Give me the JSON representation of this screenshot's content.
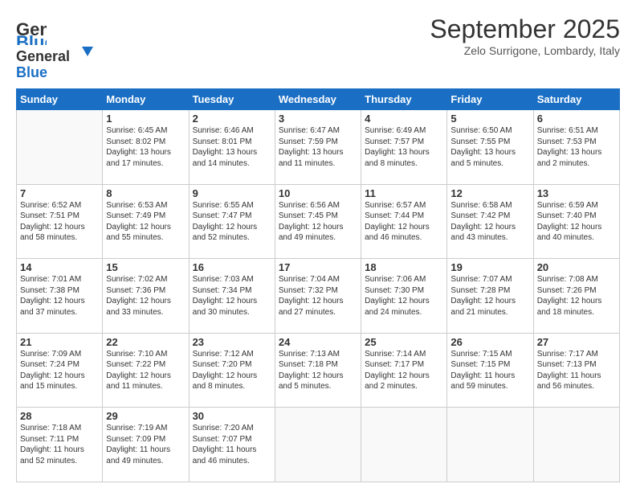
{
  "header": {
    "logo_general": "General",
    "logo_blue": "Blue",
    "title": "September 2025",
    "location": "Zelo Surrigone, Lombardy, Italy"
  },
  "weekdays": [
    "Sunday",
    "Monday",
    "Tuesday",
    "Wednesday",
    "Thursday",
    "Friday",
    "Saturday"
  ],
  "weeks": [
    [
      {
        "day": "",
        "info": ""
      },
      {
        "day": "1",
        "info": "Sunrise: 6:45 AM\nSunset: 8:02 PM\nDaylight: 13 hours\nand 17 minutes."
      },
      {
        "day": "2",
        "info": "Sunrise: 6:46 AM\nSunset: 8:01 PM\nDaylight: 13 hours\nand 14 minutes."
      },
      {
        "day": "3",
        "info": "Sunrise: 6:47 AM\nSunset: 7:59 PM\nDaylight: 13 hours\nand 11 minutes."
      },
      {
        "day": "4",
        "info": "Sunrise: 6:49 AM\nSunset: 7:57 PM\nDaylight: 13 hours\nand 8 minutes."
      },
      {
        "day": "5",
        "info": "Sunrise: 6:50 AM\nSunset: 7:55 PM\nDaylight: 13 hours\nand 5 minutes."
      },
      {
        "day": "6",
        "info": "Sunrise: 6:51 AM\nSunset: 7:53 PM\nDaylight: 13 hours\nand 2 minutes."
      }
    ],
    [
      {
        "day": "7",
        "info": "Sunrise: 6:52 AM\nSunset: 7:51 PM\nDaylight: 12 hours\nand 58 minutes."
      },
      {
        "day": "8",
        "info": "Sunrise: 6:53 AM\nSunset: 7:49 PM\nDaylight: 12 hours\nand 55 minutes."
      },
      {
        "day": "9",
        "info": "Sunrise: 6:55 AM\nSunset: 7:47 PM\nDaylight: 12 hours\nand 52 minutes."
      },
      {
        "day": "10",
        "info": "Sunrise: 6:56 AM\nSunset: 7:45 PM\nDaylight: 12 hours\nand 49 minutes."
      },
      {
        "day": "11",
        "info": "Sunrise: 6:57 AM\nSunset: 7:44 PM\nDaylight: 12 hours\nand 46 minutes."
      },
      {
        "day": "12",
        "info": "Sunrise: 6:58 AM\nSunset: 7:42 PM\nDaylight: 12 hours\nand 43 minutes."
      },
      {
        "day": "13",
        "info": "Sunrise: 6:59 AM\nSunset: 7:40 PM\nDaylight: 12 hours\nand 40 minutes."
      }
    ],
    [
      {
        "day": "14",
        "info": "Sunrise: 7:01 AM\nSunset: 7:38 PM\nDaylight: 12 hours\nand 37 minutes."
      },
      {
        "day": "15",
        "info": "Sunrise: 7:02 AM\nSunset: 7:36 PM\nDaylight: 12 hours\nand 33 minutes."
      },
      {
        "day": "16",
        "info": "Sunrise: 7:03 AM\nSunset: 7:34 PM\nDaylight: 12 hours\nand 30 minutes."
      },
      {
        "day": "17",
        "info": "Sunrise: 7:04 AM\nSunset: 7:32 PM\nDaylight: 12 hours\nand 27 minutes."
      },
      {
        "day": "18",
        "info": "Sunrise: 7:06 AM\nSunset: 7:30 PM\nDaylight: 12 hours\nand 24 minutes."
      },
      {
        "day": "19",
        "info": "Sunrise: 7:07 AM\nSunset: 7:28 PM\nDaylight: 12 hours\nand 21 minutes."
      },
      {
        "day": "20",
        "info": "Sunrise: 7:08 AM\nSunset: 7:26 PM\nDaylight: 12 hours\nand 18 minutes."
      }
    ],
    [
      {
        "day": "21",
        "info": "Sunrise: 7:09 AM\nSunset: 7:24 PM\nDaylight: 12 hours\nand 15 minutes."
      },
      {
        "day": "22",
        "info": "Sunrise: 7:10 AM\nSunset: 7:22 PM\nDaylight: 12 hours\nand 11 minutes."
      },
      {
        "day": "23",
        "info": "Sunrise: 7:12 AM\nSunset: 7:20 PM\nDaylight: 12 hours\nand 8 minutes."
      },
      {
        "day": "24",
        "info": "Sunrise: 7:13 AM\nSunset: 7:18 PM\nDaylight: 12 hours\nand 5 minutes."
      },
      {
        "day": "25",
        "info": "Sunrise: 7:14 AM\nSunset: 7:17 PM\nDaylight: 12 hours\nand 2 minutes."
      },
      {
        "day": "26",
        "info": "Sunrise: 7:15 AM\nSunset: 7:15 PM\nDaylight: 11 hours\nand 59 minutes."
      },
      {
        "day": "27",
        "info": "Sunrise: 7:17 AM\nSunset: 7:13 PM\nDaylight: 11 hours\nand 56 minutes."
      }
    ],
    [
      {
        "day": "28",
        "info": "Sunrise: 7:18 AM\nSunset: 7:11 PM\nDaylight: 11 hours\nand 52 minutes."
      },
      {
        "day": "29",
        "info": "Sunrise: 7:19 AM\nSunset: 7:09 PM\nDaylight: 11 hours\nand 49 minutes."
      },
      {
        "day": "30",
        "info": "Sunrise: 7:20 AM\nSunset: 7:07 PM\nDaylight: 11 hours\nand 46 minutes."
      },
      {
        "day": "",
        "info": ""
      },
      {
        "day": "",
        "info": ""
      },
      {
        "day": "",
        "info": ""
      },
      {
        "day": "",
        "info": ""
      }
    ]
  ]
}
